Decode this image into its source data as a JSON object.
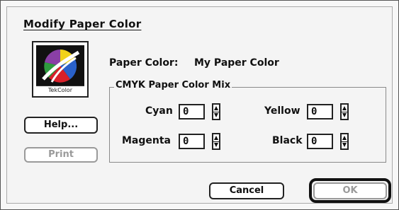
{
  "dialog": {
    "title": "Modify Paper Color",
    "logo_label": "TekColor"
  },
  "paper_color": {
    "label": "Paper Color:",
    "value": "My Paper Color"
  },
  "cmyk": {
    "group_title": "CMYK Paper Color Mix",
    "cyan": {
      "label": "Cyan",
      "value": "0"
    },
    "magenta": {
      "label": "Magenta",
      "value": "0"
    },
    "yellow": {
      "label": "Yellow",
      "value": "0"
    },
    "black": {
      "label": "Black",
      "value": "0"
    }
  },
  "buttons": {
    "help": "Help...",
    "print": "Print",
    "cancel": "Cancel",
    "ok": "OK"
  },
  "colors": {
    "logo_red": "#d8202a",
    "logo_yellow": "#f2d21b",
    "logo_blue": "#2a61c9",
    "logo_green": "#2e9a3e",
    "logo_purple": "#8a3fa6"
  }
}
